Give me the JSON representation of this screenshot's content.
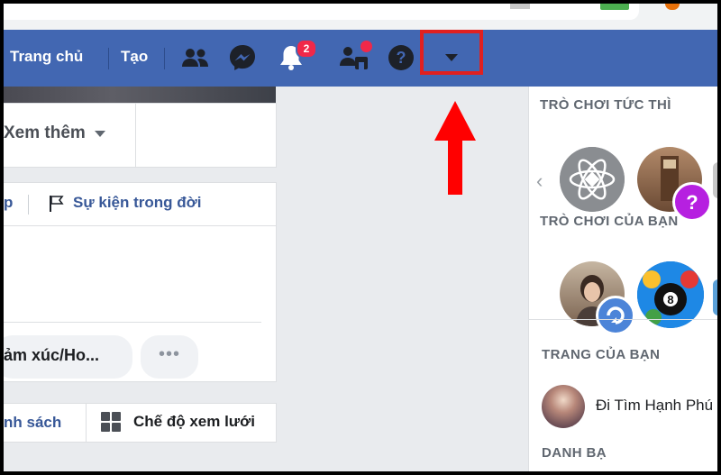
{
  "navbar": {
    "home_label": "Trang chủ",
    "create_label": "Tạo",
    "notification_count": "2",
    "icons": [
      "friends-icon",
      "messenger-icon",
      "bell-icon",
      "friend-requests-icon",
      "help-icon",
      "chevron-down-icon"
    ]
  },
  "profile": {
    "more_label": "Xem thêm",
    "composer_link_left": "p",
    "life_event_label": "Sự kiện trong đời",
    "feeling_label": "ảm xúc/Ho...",
    "more_options_label": "•••",
    "list_view_label": "nh sách",
    "grid_view_label": "Chế độ xem lưới"
  },
  "sidebar": {
    "instant_games_heading": "TRÒ CHƠI TỨC THÌ",
    "your_games_heading": "TRÒ CHƠI CỦA BẠN",
    "your_pages_heading": "TRANG CỦA BẠN",
    "page_name": "Đi Tìm Hạnh Phú",
    "contacts_heading": "DANH BẠ"
  },
  "colors": {
    "navbar": "#4267b2",
    "highlight": "#e02020",
    "arrow": "#ff0000",
    "link": "#385898",
    "background": "#e9ebee"
  }
}
